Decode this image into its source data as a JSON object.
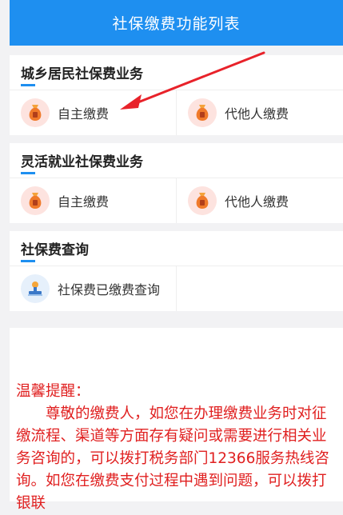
{
  "header": {
    "title": "社保缴费功能列表"
  },
  "sections": [
    {
      "title": "城乡居民社保费业务",
      "items": [
        {
          "label": "自主缴费",
          "icon": "money-bag-icon"
        },
        {
          "label": "代他人缴费",
          "icon": "money-bag-icon"
        }
      ]
    },
    {
      "title": "灵活就业社保费业务",
      "items": [
        {
          "label": "自主缴费",
          "icon": "money-bag-icon"
        },
        {
          "label": "代他人缴费",
          "icon": "money-bag-icon"
        }
      ]
    },
    {
      "title": "社保费查询",
      "items": [
        {
          "label": "社保费已缴费查询",
          "icon": "query-stamp-icon"
        }
      ]
    }
  ],
  "notice": {
    "heading": "温馨提醒：",
    "body": "尊敬的缴费人，如您在办理缴费业务时对征缴流程、渠道等方面存有疑问或需要进行相关业务咨询的，可以拨打税务部门12366服务热线咨询。如您在缴费支付过程中遇到问题，可以拨打银联"
  },
  "colors": {
    "header_bg": "#1e8ff0",
    "accent": "#1e8ff0",
    "annotation_arrow": "#e8222a",
    "notice_text": "#e02020"
  }
}
